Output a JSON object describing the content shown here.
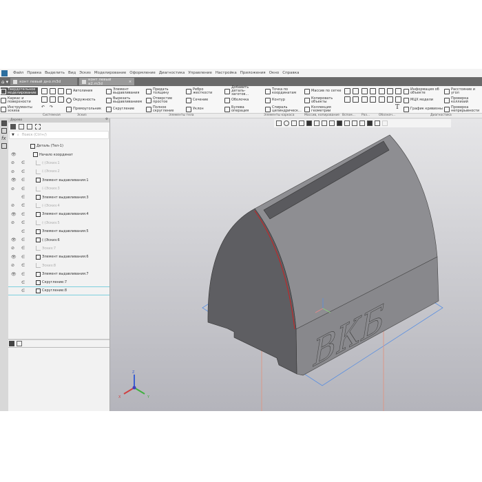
{
  "menu": [
    "Файл",
    "Правка",
    "Выделить",
    "Вид",
    "Эскиз",
    "Моделирование",
    "Оформление",
    "Диагностика",
    "Управление",
    "Настройка",
    "Приложения",
    "Окно",
    "Справка"
  ],
  "tabs": [
    {
      "label": "конт левый дно.m3d",
      "active": false
    },
    {
      "label": "конт левый в2.m3d",
      "active": true,
      "close": "×"
    }
  ],
  "modes": [
    "Твердотельное моделирование",
    "Каркас и поверхности",
    "Инструменты эскиза"
  ],
  "ribbon": {
    "sketch": [
      "Автолиния",
      "Окружность",
      "Прямоугольник"
    ],
    "body1": [
      "Элемент выдавливания",
      "Вырезать выдавливанием",
      "Скругление"
    ],
    "body2": [
      "Придать толщину",
      "Отверстие простое",
      "Полное скругление"
    ],
    "body3": [
      "Ребро жесткости",
      "Сечение",
      "Уклон"
    ],
    "body4": [
      "Добавить деталь-заготов...",
      "Оболочка",
      "Булева операция"
    ],
    "frame": [
      "Точка по координатам",
      "Контур",
      "Спираль цилиндрическ..."
    ],
    "arrays": [
      "Массив по сетке",
      "Копировать объекты",
      "Коллекция геометрии"
    ],
    "diag1": [
      "Информация об объекте",
      "МЦХ модели",
      "График кривизны"
    ],
    "diag2": [
      "Расстояние и угол",
      "Проверка коллизий",
      "Проверка непрерывности"
    ]
  },
  "group_labels": [
    "Системная",
    "Эскиз",
    "Элементы тела",
    "Элементы каркаса",
    "Массив, копирование",
    "Вспом...",
    "Раз...",
    "Обознач...",
    "Диагностика"
  ],
  "tree": {
    "title": "Дерево",
    "search_placeholder": "Поиск (Ctrl+/)",
    "rows": [
      {
        "label": "Деталь (Тел-1)",
        "eye": "",
        "inc": "",
        "dim": false
      },
      {
        "label": "Начало координат",
        "eye": "👁",
        "inc": "",
        "dim": false
      },
      {
        "label": "(-)Эскиз:1",
        "eye": "⊘",
        "inc": "∈",
        "dim": true
      },
      {
        "label": "(-)Эскиз:2",
        "eye": "⊘",
        "inc": "∈",
        "dim": true
      },
      {
        "label": "Элемент выдавливания:1",
        "eye": "👁",
        "inc": "∈",
        "dim": false
      },
      {
        "label": "(-)Эскиз:3",
        "eye": "⊘",
        "inc": "∈",
        "dim": true
      },
      {
        "label": "Элемент выдавливания:3",
        "eye": "",
        "inc": "∈",
        "dim": false
      },
      {
        "label": "(-)Эскиз:4",
        "eye": "⊘",
        "inc": "∈",
        "dim": true
      },
      {
        "label": "Элемент выдавливания:4",
        "eye": "👁",
        "inc": "∈",
        "dim": false
      },
      {
        "label": "(-)Эскиз:5",
        "eye": "⊘",
        "inc": "∈",
        "dim": true
      },
      {
        "label": "Элемент выдавливания:5",
        "eye": "",
        "inc": "∈",
        "dim": false
      },
      {
        "label": "(-)Эскиз:6",
        "eye": "👁",
        "inc": "∈",
        "dim": false
      },
      {
        "label": "Эскиз:7",
        "eye": "⊘",
        "inc": "∈",
        "dim": true
      },
      {
        "label": "Элемент выдавливания:6",
        "eye": "👁",
        "inc": "∈",
        "dim": false
      },
      {
        "label": "Эскиз:8",
        "eye": "⊘",
        "inc": "∈",
        "dim": true
      },
      {
        "label": "Элемент выдавливания:7",
        "eye": "👁",
        "inc": "∈",
        "dim": false
      },
      {
        "label": "Скругление:7",
        "eye": "",
        "inc": "∈",
        "dim": false
      },
      {
        "label": "Скругление:8",
        "eye": "",
        "inc": "∈",
        "dim": false
      }
    ]
  },
  "model": {
    "engraving": "ВКБ",
    "axes": {
      "x": "X",
      "y": "Y",
      "z": "Z"
    }
  },
  "colors": {
    "plane_xy": "#5a8fe0",
    "plane_zx": "#ee8a8a",
    "plane_yz": "#88d878",
    "selected_edge": "#cc2020"
  }
}
